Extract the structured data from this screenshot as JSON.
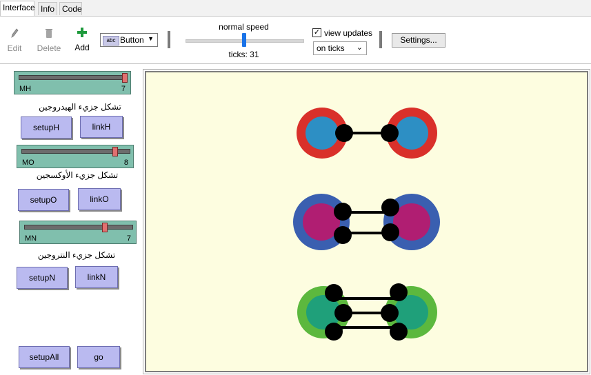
{
  "tabs": [
    "Interface",
    "Info",
    "Code"
  ],
  "toolbar": {
    "edit": "Edit",
    "delete": "Delete",
    "add": "Add",
    "widget_type": "Button",
    "widget_icon_text": "abc",
    "speed_label": "normal speed",
    "speed_fraction": 0.5,
    "ticks_label": "ticks: 31",
    "view_updates_label": "view updates",
    "view_updates_checked": true,
    "update_mode": "on ticks",
    "settings": "Settings..."
  },
  "widgets": {
    "slider_mh": {
      "name": "MH",
      "value": "7",
      "fraction": 1.0
    },
    "label_h": "تشكل جزيء الهيدروجين",
    "btn_setuph": "setupH",
    "btn_linkh": "linkH",
    "slider_mo": {
      "name": "MO",
      "value": "8",
      "fraction": 0.88
    },
    "label_o": "تشكل جزيء الأوكسجين",
    "btn_setupo": "setupO",
    "btn_linko": "linkO",
    "slider_mn": {
      "name": "MN",
      "value": "7",
      "fraction": 0.75
    },
    "label_n": "تشكل جزيء النتروجين",
    "btn_setupn": "setupN",
    "btn_linkn": "linkN",
    "btn_setupall": "setupAll",
    "btn_go": "go"
  },
  "colors": {
    "world_bg": "#fdfde0",
    "hydrogen_outer": "#d9302a",
    "hydrogen_inner": "#2d8fc4",
    "oxygen_outer": "#3a5fb0",
    "oxygen_inner": "#b01e72",
    "nitrogen_outer": "#5cb83e",
    "nitrogen_inner": "#1fa07a",
    "bond": "#000000"
  }
}
